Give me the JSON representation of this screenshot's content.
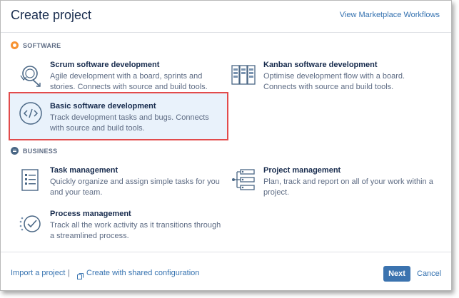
{
  "header": {
    "title": "Create project",
    "marketplace_link": "View Marketplace Workflows"
  },
  "sections": {
    "software": {
      "label": "SOFTWARE",
      "icon": "software-category-icon",
      "color": "#f79232"
    },
    "business": {
      "label": "BUSINESS",
      "icon": "business-category-icon",
      "color": "#4a6785"
    }
  },
  "templates": {
    "scrum": {
      "name": "Scrum software development",
      "desc": "Agile development with a board, sprints and stories. Connects with source and build tools.",
      "icon": "scrum-cycle-icon"
    },
    "kanban": {
      "name": "Kanban software development",
      "desc": "Optimise development flow with a board. Connects with source and build tools.",
      "icon": "kanban-board-icon"
    },
    "basic": {
      "name": "Basic software development",
      "desc": "Track development tasks and bugs. Connects with source and build tools.",
      "icon": "code-icon",
      "selected": true
    },
    "task": {
      "name": "Task management",
      "desc": "Quickly organize and assign simple tasks for you and your team.",
      "icon": "checklist-icon"
    },
    "project": {
      "name": "Project management",
      "desc": "Plan, track and report on all of your work within a project.",
      "icon": "project-flow-icon"
    },
    "process": {
      "name": "Process management",
      "desc": "Track all the work activity as it transitions through a streamlined process.",
      "icon": "process-check-icon"
    }
  },
  "footer": {
    "import_link": "Import a project",
    "separator": "|",
    "shared_config_link": "Create with shared configuration",
    "next_button": "Next",
    "cancel_link": "Cancel"
  },
  "colors": {
    "accent": "#3b73af",
    "link": "#3572b0",
    "selected_bg": "#e9f2fb",
    "highlight_border": "#e24b4b"
  }
}
